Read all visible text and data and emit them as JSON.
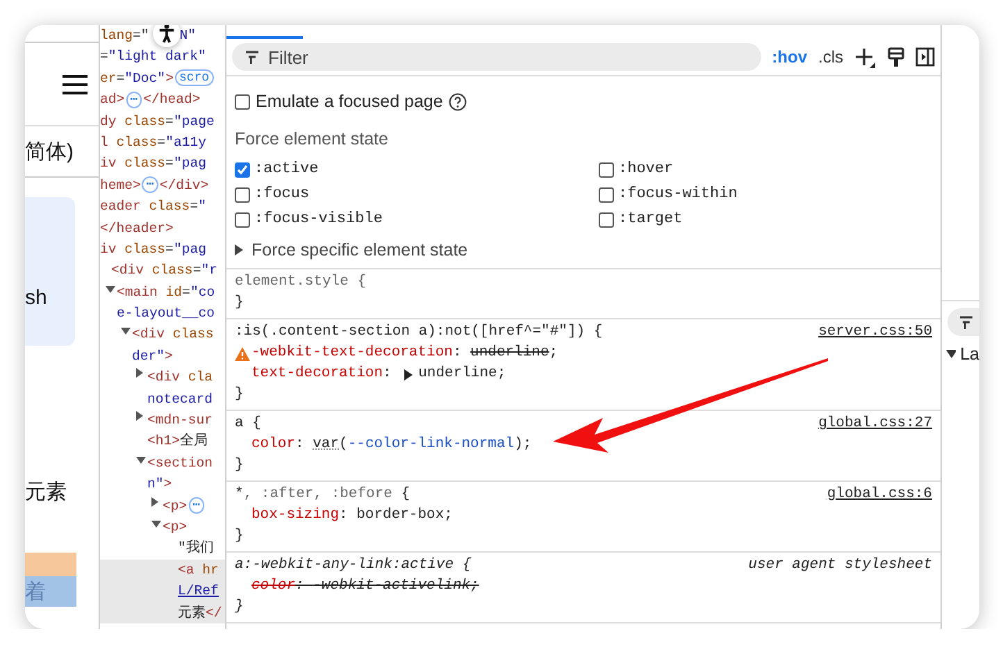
{
  "page_preview": {
    "language_label": "简体)",
    "card_text": "sh",
    "body_text": "元素",
    "banner_text": "着"
  },
  "dom_tree": {
    "clipped_lines": [
      [
        {
          "t": "lang",
          "kind": "attr"
        },
        {
          "t": "=\"",
          "kind": "plain"
        },
        {
          "kind": "a11y"
        },
        {
          "t": "N\"",
          "kind": "value"
        }
      ],
      [
        {
          "t": "=",
          "kind": "plain"
        },
        {
          "t": "\"light dark\"",
          "kind": "value"
        }
      ],
      [
        {
          "t": "er",
          "kind": "attr"
        },
        {
          "t": "=",
          "kind": "plain"
        },
        {
          "t": "\"Doc\"",
          "kind": "value"
        },
        {
          "t": ">",
          "kind": "tag"
        },
        {
          "t": "scro",
          "kind": "badge"
        }
      ],
      [
        {
          "t": "ad>",
          "kind": "tag"
        },
        {
          "t": "⋯",
          "kind": "badge"
        },
        {
          "t": "</head>",
          "kind": "tag"
        }
      ],
      [
        {
          "t": "dy",
          "kind": "tag"
        },
        {
          "t": " class",
          "kind": "attr"
        },
        {
          "t": "=",
          "kind": "plain"
        },
        {
          "t": "\"page",
          "kind": "value"
        }
      ],
      [
        {
          "t": "l",
          "kind": "tag"
        },
        {
          "t": " class",
          "kind": "attr"
        },
        {
          "t": "=",
          "kind": "plain"
        },
        {
          "t": "\"a11y",
          "kind": "value"
        }
      ],
      [
        {
          "t": "iv",
          "kind": "tag"
        },
        {
          "t": " class",
          "kind": "attr"
        },
        {
          "t": "=",
          "kind": "plain"
        },
        {
          "t": "\"pag",
          "kind": "value"
        }
      ],
      [
        {
          "t": "heme>",
          "kind": "tag"
        },
        {
          "t": "⋯",
          "kind": "badge"
        },
        {
          "t": "</div>",
          "kind": "tag"
        }
      ],
      [
        {
          "t": "eader",
          "kind": "tag"
        },
        {
          "t": " class",
          "kind": "attr"
        },
        {
          "t": "=",
          "kind": "plain"
        },
        {
          "t": "\"",
          "kind": "value"
        }
      ],
      [
        {
          "t": "</header>",
          "kind": "tag"
        }
      ],
      [
        {
          "t": "iv",
          "kind": "tag"
        },
        {
          "t": " class",
          "kind": "attr"
        },
        {
          "t": "=",
          "kind": "plain"
        },
        {
          "t": "\"pag",
          "kind": "value"
        }
      ]
    ],
    "nodes": [
      {
        "expandable": false,
        "selected": false,
        "lines": [
          [
            {
              "t": "<div",
              "kind": "tag"
            },
            {
              "t": " class",
              "kind": "attr"
            },
            {
              "t": "=",
              "kind": "plain"
            },
            {
              "t": "\"r",
              "kind": "value"
            }
          ]
        ],
        "children": [
          {
            "expandable": true,
            "expanded": true,
            "selected": false,
            "lines": [
              [
                {
                  "t": "<main",
                  "kind": "tag"
                },
                {
                  "t": " id",
                  "kind": "attr"
                },
                {
                  "t": "=",
                  "kind": "plain"
                },
                {
                  "t": "\"co",
                  "kind": "value"
                }
              ],
              [
                {
                  "t": "e-layout__co",
                  "kind": "value"
                }
              ]
            ],
            "children": [
              {
                "expandable": true,
                "expanded": true,
                "selected": false,
                "lines": [
                  [
                    {
                      "t": "<div",
                      "kind": "tag"
                    },
                    {
                      "t": " class",
                      "kind": "attr"
                    }
                  ],
                  [
                    {
                      "t": "der\"",
                      "kind": "value"
                    },
                    {
                      "t": ">",
                      "kind": "tag"
                    }
                  ]
                ],
                "children": [
                  {
                    "expandable": true,
                    "expanded": false,
                    "selected": false,
                    "lines": [
                      [
                        {
                          "t": "<div",
                          "kind": "tag"
                        },
                        {
                          "t": " cla",
                          "kind": "attr"
                        }
                      ],
                      [
                        {
                          "t": "notecard",
                          "kind": "value"
                        }
                      ]
                    ]
                  },
                  {
                    "expandable": true,
                    "expanded": false,
                    "selected": false,
                    "lines": [
                      [
                        {
                          "t": "<mdn-sur",
                          "kind": "tag"
                        }
                      ]
                    ]
                  },
                  {
                    "expandable": false,
                    "selected": false,
                    "lines": [
                      [
                        {
                          "t": "<h1>",
                          "kind": "tag"
                        },
                        {
                          "t": "全局",
                          "kind": "text"
                        }
                      ]
                    ]
                  },
                  {
                    "expandable": true,
                    "expanded": true,
                    "selected": false,
                    "lines": [
                      [
                        {
                          "t": "<section",
                          "kind": "tag"
                        }
                      ],
                      [
                        {
                          "t": "n\"",
                          "kind": "value"
                        },
                        {
                          "t": ">",
                          "kind": "tag"
                        }
                      ]
                    ],
                    "children": [
                      {
                        "expandable": true,
                        "expanded": false,
                        "selected": false,
                        "lines": [
                          [
                            {
                              "t": "<p>",
                              "kind": "tag"
                            },
                            {
                              "t": "⋯",
                              "kind": "badge"
                            }
                          ]
                        ]
                      },
                      {
                        "expandable": true,
                        "expanded": true,
                        "selected": false,
                        "lines": [
                          [
                            {
                              "t": "<p>",
                              "kind": "tag"
                            }
                          ]
                        ],
                        "children": [
                          {
                            "expandable": false,
                            "selected": false,
                            "lines": [
                              [
                                {
                                  "t": "\"我们",
                                  "kind": "text"
                                }
                              ]
                            ]
                          },
                          {
                            "expandable": false,
                            "selected": true,
                            "lines": [
                              [
                                {
                                  "t": "<a",
                                  "kind": "tag"
                                },
                                {
                                  "t": " hr",
                                  "kind": "attr"
                                }
                              ],
                              [
                                {
                                  "t": "L/Ref",
                                  "kind": "link"
                                }
                              ],
                              [
                                {
                                  "t": "元素",
                                  "kind": "text"
                                },
                                {
                                  "t": "</",
                                  "kind": "tag"
                                }
                              ]
                            ]
                          }
                        ]
                      }
                    ]
                  }
                ]
              }
            ]
          }
        ]
      }
    ]
  },
  "styles": {
    "filter": {
      "placeholder": "Filter"
    },
    "toggles": [
      {
        "label": ":hov",
        "selected": true
      },
      {
        "label": ".cls",
        "selected": false
      }
    ],
    "emulate_focus": {
      "label": "Emulate a focused page",
      "checked": false
    },
    "force_state": {
      "title": "Force element state",
      "states": [
        {
          "label": ":active",
          "checked": true
        },
        {
          "label": ":hover",
          "checked": false
        },
        {
          "label": ":focus",
          "checked": false
        },
        {
          "label": ":focus-within",
          "checked": false
        },
        {
          "label": ":focus-visible",
          "checked": false
        },
        {
          "label": ":target",
          "checked": false
        }
      ],
      "specific": {
        "label": "Force specific element state",
        "expanded": false
      }
    },
    "rules": [
      {
        "selector": [
          {
            "t": "element.style {",
            "kind": "dim"
          }
        ],
        "italic": false,
        "close": "}"
      },
      {
        "selector": [
          {
            "t": ":is(.content-section a):not([href^=\"#\"]) {",
            "kind": "match"
          }
        ],
        "italic": false,
        "source": {
          "text": "server.css:50",
          "kind": "link"
        },
        "decls": [
          {
            "warning": true,
            "overridden": false,
            "tokens": [
              {
                "t": "-webkit-text-decoration",
                "kind": "prop"
              },
              {
                "t": ": ",
                "kind": "plain"
              },
              {
                "t": "underline",
                "kind": "struck"
              },
              {
                "t": ";",
                "kind": "plain"
              }
            ]
          },
          {
            "warning": false,
            "overridden": false,
            "tokens": [
              {
                "t": "text-decoration",
                "kind": "prop"
              },
              {
                "t": ": ",
                "kind": "plain"
              },
              {
                "kind": "expander"
              },
              {
                "t": "underline;",
                "kind": "plain"
              }
            ]
          }
        ],
        "close": "}"
      },
      {
        "selector": [
          {
            "t": "a {",
            "kind": "match"
          }
        ],
        "italic": false,
        "source": {
          "text": "global.css:27",
          "kind": "link"
        },
        "decls": [
          {
            "warning": false,
            "overridden": false,
            "tokens": [
              {
                "t": "color",
                "kind": "prop"
              },
              {
                "t": ": ",
                "kind": "plain"
              },
              {
                "t": "var",
                "kind": "func"
              },
              {
                "t": "(",
                "kind": "plain"
              },
              {
                "t": "--color-link-normal",
                "kind": "variable"
              },
              {
                "t": ");",
                "kind": "plain"
              }
            ]
          }
        ],
        "close": "}"
      },
      {
        "selector": [
          {
            "t": "*",
            "kind": "match"
          },
          {
            "t": ", :after, :before",
            "kind": "dim"
          },
          {
            "t": " {",
            "kind": "match"
          }
        ],
        "italic": false,
        "source": {
          "text": "global.css:6",
          "kind": "link"
        },
        "decls": [
          {
            "warning": false,
            "overridden": false,
            "tokens": [
              {
                "t": "box-sizing",
                "kind": "prop"
              },
              {
                "t": ": ",
                "kind": "plain"
              },
              {
                "t": "border-box;",
                "kind": "plain"
              }
            ]
          }
        ],
        "close": "}"
      },
      {
        "selector": [
          {
            "t": "a:-webkit-any-link:active {",
            "kind": "match"
          }
        ],
        "italic": true,
        "source": {
          "text": "user agent stylesheet",
          "kind": "agent"
        },
        "decls": [
          {
            "warning": false,
            "overridden": true,
            "tokens": [
              {
                "t": "color",
                "kind": "prop"
              },
              {
                "t": ": ",
                "kind": "plain"
              },
              {
                "t": "-webkit-activelink;",
                "kind": "plain"
              }
            ]
          }
        ],
        "close": "}"
      }
    ]
  },
  "right_panel": {
    "section": "La",
    "expanded": true
  }
}
